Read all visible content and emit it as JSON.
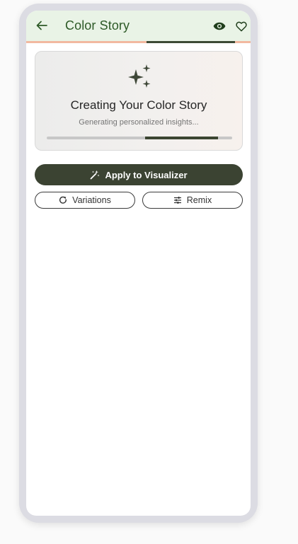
{
  "app_bar": {
    "title": "Color Story",
    "back_icon": "arrow-left-icon",
    "preview_icon": "eye-icon",
    "favorite_icon": "heart-outline-icon",
    "background_color": "#e9f3e6",
    "title_color": "#2d5a27"
  },
  "top_progress": {
    "track_color": "#f2b9a0",
    "fill_color": "#3d4a35"
  },
  "story_card": {
    "icon": "sparkles-icon",
    "title": "Creating Your Color Story",
    "subtitle": "Generating personalized insights...",
    "progress_fill_color": "#3b4531"
  },
  "actions": {
    "apply_label": "Apply to Visualizer",
    "apply_icon": "magic-wand-icon",
    "apply_color": "#3b4332",
    "variations_label": "Variations",
    "variations_icon": "refresh-icon",
    "remix_label": "Remix",
    "remix_icon": "tune-icon"
  }
}
